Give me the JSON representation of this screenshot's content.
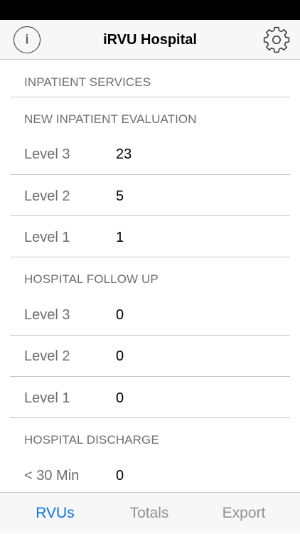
{
  "nav": {
    "title": "iRVU Hospital",
    "info_icon": "info-icon",
    "settings_icon": "gear-icon"
  },
  "list": {
    "group_title": "INPATIENT SERVICES",
    "sections": [
      {
        "header": "NEW INPATIENT EVALUATION",
        "rows": [
          {
            "label": "Level 3",
            "value": "23"
          },
          {
            "label": "Level 2",
            "value": "5"
          },
          {
            "label": "Level 1",
            "value": "1"
          }
        ]
      },
      {
        "header": "HOSPITAL FOLLOW UP",
        "rows": [
          {
            "label": "Level 3",
            "value": "0"
          },
          {
            "label": "Level 2",
            "value": "0"
          },
          {
            "label": "Level 1",
            "value": "0"
          }
        ]
      },
      {
        "header": "HOSPITAL DISCHARGE",
        "rows": [
          {
            "label": "< 30 Min",
            "value": "0"
          }
        ]
      }
    ]
  },
  "tabs": [
    {
      "label": "RVUs",
      "active": true
    },
    {
      "label": "Totals"
    },
    {
      "label": "Export"
    }
  ],
  "colors": {
    "accent": "#0a73e8",
    "inactive_tab": "#929292",
    "secondary_text": "#6d6d72"
  }
}
